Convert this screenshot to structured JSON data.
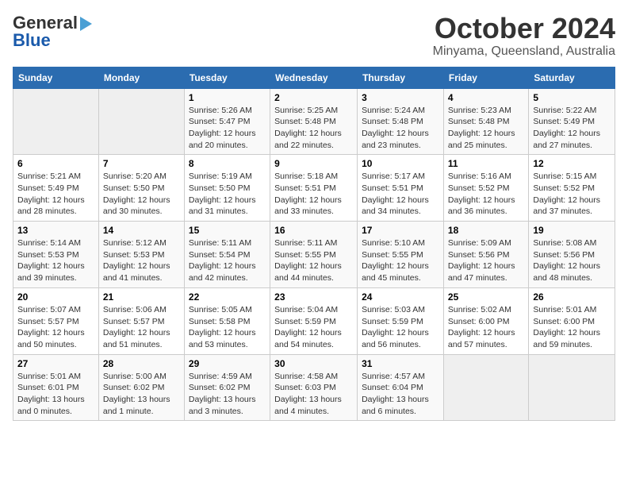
{
  "header": {
    "logo_general": "General",
    "logo_blue": "Blue",
    "month_title": "October 2024",
    "location": "Minyama, Queensland, Australia"
  },
  "weekdays": [
    "Sunday",
    "Monday",
    "Tuesday",
    "Wednesday",
    "Thursday",
    "Friday",
    "Saturday"
  ],
  "weeks": [
    [
      {
        "day": "",
        "sunrise": "",
        "sunset": "",
        "daylight": ""
      },
      {
        "day": "",
        "sunrise": "",
        "sunset": "",
        "daylight": ""
      },
      {
        "day": "1",
        "sunrise": "Sunrise: 5:26 AM",
        "sunset": "Sunset: 5:47 PM",
        "daylight": "Daylight: 12 hours and 20 minutes."
      },
      {
        "day": "2",
        "sunrise": "Sunrise: 5:25 AM",
        "sunset": "Sunset: 5:48 PM",
        "daylight": "Daylight: 12 hours and 22 minutes."
      },
      {
        "day": "3",
        "sunrise": "Sunrise: 5:24 AM",
        "sunset": "Sunset: 5:48 PM",
        "daylight": "Daylight: 12 hours and 23 minutes."
      },
      {
        "day": "4",
        "sunrise": "Sunrise: 5:23 AM",
        "sunset": "Sunset: 5:48 PM",
        "daylight": "Daylight: 12 hours and 25 minutes."
      },
      {
        "day": "5",
        "sunrise": "Sunrise: 5:22 AM",
        "sunset": "Sunset: 5:49 PM",
        "daylight": "Daylight: 12 hours and 27 minutes."
      }
    ],
    [
      {
        "day": "6",
        "sunrise": "Sunrise: 5:21 AM",
        "sunset": "Sunset: 5:49 PM",
        "daylight": "Daylight: 12 hours and 28 minutes."
      },
      {
        "day": "7",
        "sunrise": "Sunrise: 5:20 AM",
        "sunset": "Sunset: 5:50 PM",
        "daylight": "Daylight: 12 hours and 30 minutes."
      },
      {
        "day": "8",
        "sunrise": "Sunrise: 5:19 AM",
        "sunset": "Sunset: 5:50 PM",
        "daylight": "Daylight: 12 hours and 31 minutes."
      },
      {
        "day": "9",
        "sunrise": "Sunrise: 5:18 AM",
        "sunset": "Sunset: 5:51 PM",
        "daylight": "Daylight: 12 hours and 33 minutes."
      },
      {
        "day": "10",
        "sunrise": "Sunrise: 5:17 AM",
        "sunset": "Sunset: 5:51 PM",
        "daylight": "Daylight: 12 hours and 34 minutes."
      },
      {
        "day": "11",
        "sunrise": "Sunrise: 5:16 AM",
        "sunset": "Sunset: 5:52 PM",
        "daylight": "Daylight: 12 hours and 36 minutes."
      },
      {
        "day": "12",
        "sunrise": "Sunrise: 5:15 AM",
        "sunset": "Sunset: 5:52 PM",
        "daylight": "Daylight: 12 hours and 37 minutes."
      }
    ],
    [
      {
        "day": "13",
        "sunrise": "Sunrise: 5:14 AM",
        "sunset": "Sunset: 5:53 PM",
        "daylight": "Daylight: 12 hours and 39 minutes."
      },
      {
        "day": "14",
        "sunrise": "Sunrise: 5:12 AM",
        "sunset": "Sunset: 5:53 PM",
        "daylight": "Daylight: 12 hours and 41 minutes."
      },
      {
        "day": "15",
        "sunrise": "Sunrise: 5:11 AM",
        "sunset": "Sunset: 5:54 PM",
        "daylight": "Daylight: 12 hours and 42 minutes."
      },
      {
        "day": "16",
        "sunrise": "Sunrise: 5:11 AM",
        "sunset": "Sunset: 5:55 PM",
        "daylight": "Daylight: 12 hours and 44 minutes."
      },
      {
        "day": "17",
        "sunrise": "Sunrise: 5:10 AM",
        "sunset": "Sunset: 5:55 PM",
        "daylight": "Daylight: 12 hours and 45 minutes."
      },
      {
        "day": "18",
        "sunrise": "Sunrise: 5:09 AM",
        "sunset": "Sunset: 5:56 PM",
        "daylight": "Daylight: 12 hours and 47 minutes."
      },
      {
        "day": "19",
        "sunrise": "Sunrise: 5:08 AM",
        "sunset": "Sunset: 5:56 PM",
        "daylight": "Daylight: 12 hours and 48 minutes."
      }
    ],
    [
      {
        "day": "20",
        "sunrise": "Sunrise: 5:07 AM",
        "sunset": "Sunset: 5:57 PM",
        "daylight": "Daylight: 12 hours and 50 minutes."
      },
      {
        "day": "21",
        "sunrise": "Sunrise: 5:06 AM",
        "sunset": "Sunset: 5:57 PM",
        "daylight": "Daylight: 12 hours and 51 minutes."
      },
      {
        "day": "22",
        "sunrise": "Sunrise: 5:05 AM",
        "sunset": "Sunset: 5:58 PM",
        "daylight": "Daylight: 12 hours and 53 minutes."
      },
      {
        "day": "23",
        "sunrise": "Sunrise: 5:04 AM",
        "sunset": "Sunset: 5:59 PM",
        "daylight": "Daylight: 12 hours and 54 minutes."
      },
      {
        "day": "24",
        "sunrise": "Sunrise: 5:03 AM",
        "sunset": "Sunset: 5:59 PM",
        "daylight": "Daylight: 12 hours and 56 minutes."
      },
      {
        "day": "25",
        "sunrise": "Sunrise: 5:02 AM",
        "sunset": "Sunset: 6:00 PM",
        "daylight": "Daylight: 12 hours and 57 minutes."
      },
      {
        "day": "26",
        "sunrise": "Sunrise: 5:01 AM",
        "sunset": "Sunset: 6:00 PM",
        "daylight": "Daylight: 12 hours and 59 minutes."
      }
    ],
    [
      {
        "day": "27",
        "sunrise": "Sunrise: 5:01 AM",
        "sunset": "Sunset: 6:01 PM",
        "daylight": "Daylight: 13 hours and 0 minutes."
      },
      {
        "day": "28",
        "sunrise": "Sunrise: 5:00 AM",
        "sunset": "Sunset: 6:02 PM",
        "daylight": "Daylight: 13 hours and 1 minute."
      },
      {
        "day": "29",
        "sunrise": "Sunrise: 4:59 AM",
        "sunset": "Sunset: 6:02 PM",
        "daylight": "Daylight: 13 hours and 3 minutes."
      },
      {
        "day": "30",
        "sunrise": "Sunrise: 4:58 AM",
        "sunset": "Sunset: 6:03 PM",
        "daylight": "Daylight: 13 hours and 4 minutes."
      },
      {
        "day": "31",
        "sunrise": "Sunrise: 4:57 AM",
        "sunset": "Sunset: 6:04 PM",
        "daylight": "Daylight: 13 hours and 6 minutes."
      },
      {
        "day": "",
        "sunrise": "",
        "sunset": "",
        "daylight": ""
      },
      {
        "day": "",
        "sunrise": "",
        "sunset": "",
        "daylight": ""
      }
    ]
  ]
}
